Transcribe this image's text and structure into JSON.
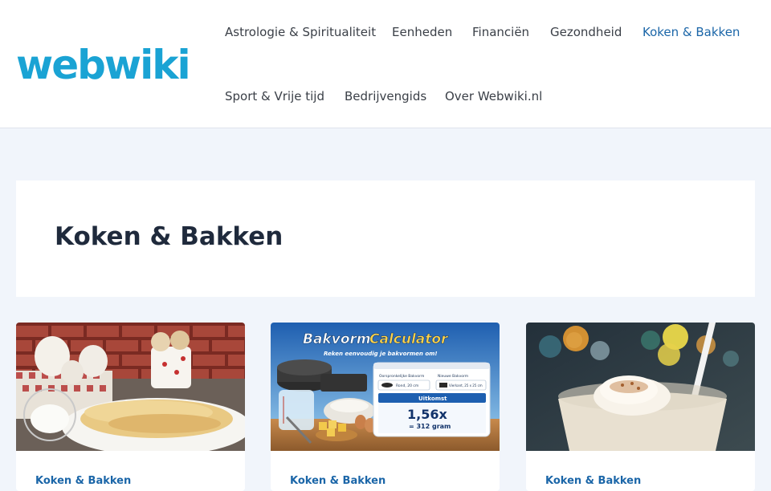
{
  "logo": {
    "text": "webwiki"
  },
  "nav": {
    "items": [
      {
        "label": "Astrologie & Spiritualiteit",
        "active": false
      },
      {
        "label": "Eenheden",
        "active": false
      },
      {
        "label": "Financiën",
        "active": false
      },
      {
        "label": "Gezondheid",
        "active": false
      },
      {
        "label": "Koken & Bakken",
        "active": true
      },
      {
        "label": "Sport & Vrije tijd",
        "active": false
      },
      {
        "label": "Bedrijvengids",
        "active": false
      },
      {
        "label": "Over Webwiki.nl",
        "active": false
      }
    ]
  },
  "page": {
    "title": "Koken & Bakken"
  },
  "cards": [
    {
      "category": "Koken & Bakken",
      "image": "pancakes-photo"
    },
    {
      "category": "Koken & Bakken",
      "image": "bakvorm-calculator-illustration",
      "illustration": {
        "title_part1": "Bakvorm",
        "title_part2": "Calculator",
        "subtitle": "Reken eenvoudig je bakvormen om!",
        "col1_label": "Oorspronkelijke Bakvorm",
        "col1_value": "Rond, 20 cm",
        "col2_label": "Nieuwe Bakvorm",
        "col2_value": "Vierkant, 25 x 25 cm",
        "result_label": "Uitkomst",
        "result_value": "1,56x",
        "result_sub": "= 312 gram"
      }
    },
    {
      "category": "Koken & Bakken",
      "image": "milkshake-photo"
    }
  ],
  "colors": {
    "brand": "#1aa3d4",
    "link": "#1b66a8",
    "background": "#f1f5fb"
  }
}
